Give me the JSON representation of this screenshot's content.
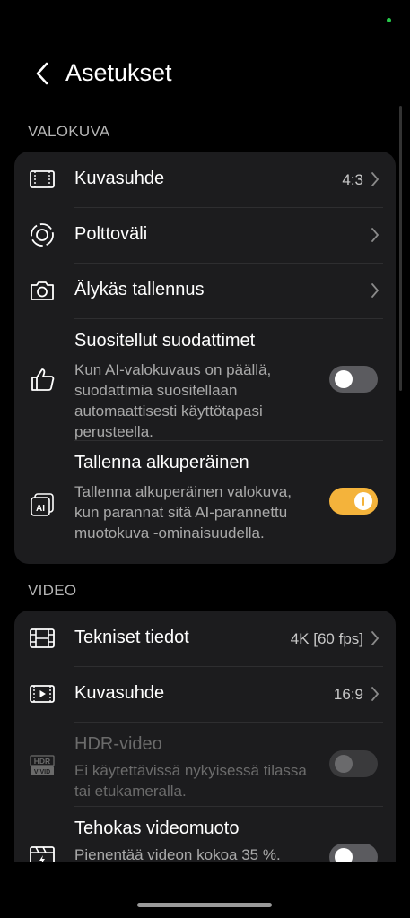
{
  "header": {
    "title": "Asetukset"
  },
  "sections": {
    "photo": {
      "label": "VALOKUVA",
      "aspect_ratio": {
        "label": "Kuvasuhde",
        "value": "4:3"
      },
      "focal_length": {
        "label": "Polttoväli"
      },
      "smart_save": {
        "label": "Älykäs tallennus"
      },
      "recommended_filters": {
        "label": "Suositellut suodattimet",
        "description": "Kun AI-valokuvaus on päällä, suodattimia suositellaan automaattisesti käyttötapasi perusteella.",
        "enabled": false
      },
      "save_original": {
        "label": "Tallenna alkuperäinen",
        "description": "Tallenna alkuperäinen valokuva, kun parannat sitä AI-parannettu muotokuva -ominaisuudella.",
        "enabled": true
      }
    },
    "video": {
      "label": "VIDEO",
      "specs": {
        "label": "Tekniset tiedot",
        "value": "4K [60 fps]"
      },
      "aspect_ratio": {
        "label": "Kuvasuhde",
        "value": "16:9"
      },
      "hdr": {
        "label": "HDR-video",
        "description": "Ei käytettävissä nykyisessä tilassa tai etukameralla.",
        "icon_text_top": "HDR",
        "icon_text_bottom": "VIVID",
        "enabled": false,
        "disabled": true
      },
      "efficient_format": {
        "label": "Tehokas videomuoto",
        "description": "Pienentää videon kokoa 35 %.",
        "enabled": false
      }
    }
  },
  "colors": {
    "accent": "#f4b33b",
    "card": "#1c1c1e",
    "background": "#000000"
  }
}
